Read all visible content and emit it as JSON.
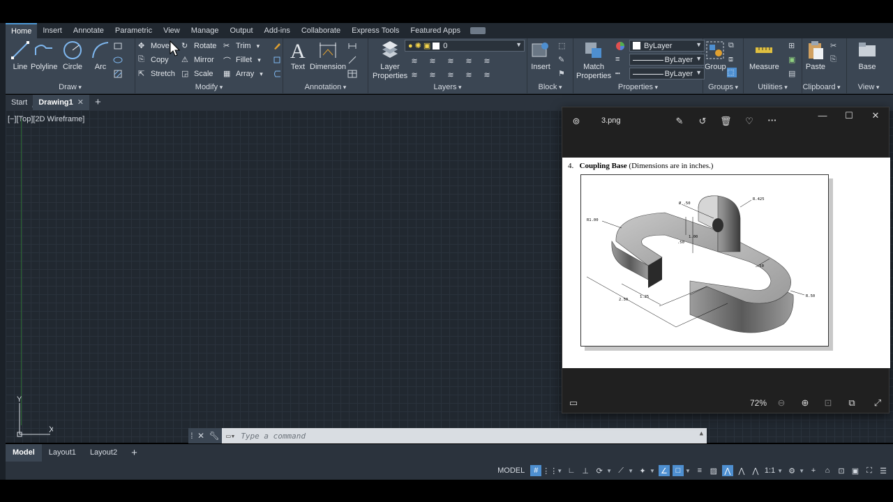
{
  "ribbon_tabs": [
    "Home",
    "Insert",
    "Annotate",
    "Parametric",
    "View",
    "Manage",
    "Output",
    "Add-ins",
    "Collaborate",
    "Express Tools",
    "Featured Apps"
  ],
  "draw": {
    "title": "Draw",
    "line": "Line",
    "polyline": "Polyline",
    "circle": "Circle",
    "arc": "Arc"
  },
  "modify": {
    "title": "Modify",
    "move": "Move",
    "rotate": "Rotate",
    "trim": "Trim",
    "copy": "Copy",
    "mirror": "Mirror",
    "fillet": "Fillet",
    "stretch": "Stretch",
    "scale": "Scale",
    "array": "Array"
  },
  "annotation": {
    "title": "Annotation",
    "text": "Text",
    "dimension": "Dimension"
  },
  "layers": {
    "title": "Layers",
    "layer_properties": "Layer\nProperties",
    "current_layer": "0"
  },
  "block": {
    "title": "Block",
    "insert": "Insert"
  },
  "properties": {
    "title": "Properties",
    "match_properties": "Match\nProperties",
    "color": "ByLayer",
    "linetype": "ByLayer",
    "lineweight": "ByLayer"
  },
  "groups": {
    "title": "Groups",
    "group": "Group"
  },
  "utilities": {
    "title": "Utilities",
    "measure": "Measure"
  },
  "clipboard": {
    "title": "Clipboard",
    "paste": "Paste"
  },
  "view_panel": {
    "title": "View",
    "base": "Base"
  },
  "file_tabs": {
    "start": "Start",
    "drawing": "Drawing1",
    "close": "✕",
    "add": "+"
  },
  "viewport_label": "[−][Top][2D Wireframe]",
  "ucs": {
    "x": "X",
    "y": "Y"
  },
  "command": {
    "placeholder": "Type a command"
  },
  "layout_tabs": [
    "Model",
    "Layout1",
    "Layout2"
  ],
  "status": {
    "model": "MODEL",
    "scale": "1:1"
  },
  "viewer": {
    "filename": "3.png",
    "caption_num": "4.",
    "caption_title": "Coupling Base",
    "caption_note": "(Dimensions are in inches.)",
    "zoom": "72%",
    "dims": {
      "hole": "Ø .50",
      "r425": "R.425",
      "r100": "R1.00",
      "d100": "1.00",
      "d50a": ".50",
      "d50b": ".50",
      "r50": "R.50",
      "d250": "2.50",
      "d125": "1.25"
    }
  },
  "colors": {
    "accent": "#4e8fd0",
    "viewport": "#212830",
    "ribbon": "#3b4653"
  }
}
